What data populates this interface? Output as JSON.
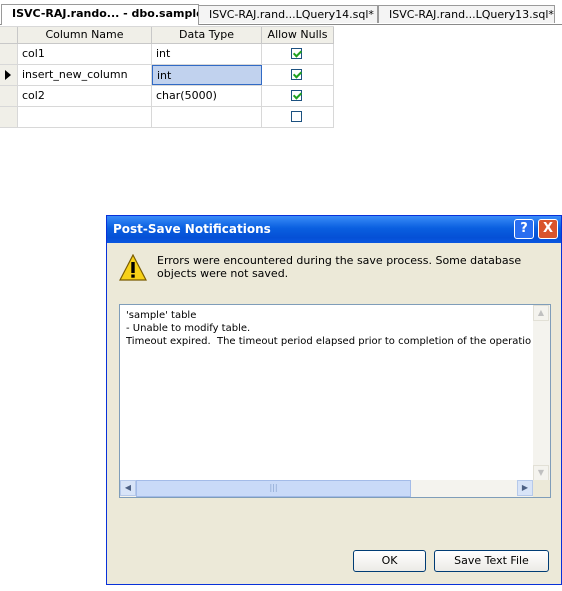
{
  "tabs": [
    {
      "label": "ISVC-RAJ.rando... - dbo.sample*"
    },
    {
      "label": "ISVC-RAJ.rand...LQuery14.sql*"
    },
    {
      "label": "ISVC-RAJ.rand...LQuery13.sql*"
    }
  ],
  "grid": {
    "headers": [
      "Column Name",
      "Data Type",
      "Allow Nulls"
    ],
    "rows": [
      {
        "name": "col1",
        "type": "int",
        "allow_nulls": true
      },
      {
        "name": "insert_new_column",
        "type": "int",
        "allow_nulls": true
      },
      {
        "name": "col2",
        "type": "char(5000)",
        "allow_nulls": true
      },
      {
        "name": "",
        "type": "",
        "allow_nulls": false
      }
    ]
  },
  "dialog": {
    "title": "Post-Save Notifications",
    "help_glyph": "?",
    "close_glyph": "X",
    "message": "Errors were encountered during the save process. Some database objects were not saved.",
    "details": [
      "'sample' table",
      "- Unable to modify table.",
      "Timeout expired.  The timeout period elapsed prior to completion of the operation or"
    ],
    "ok_label": "OK",
    "save_label": "Save Text File",
    "icons": {
      "warning": "warning-icon"
    }
  }
}
